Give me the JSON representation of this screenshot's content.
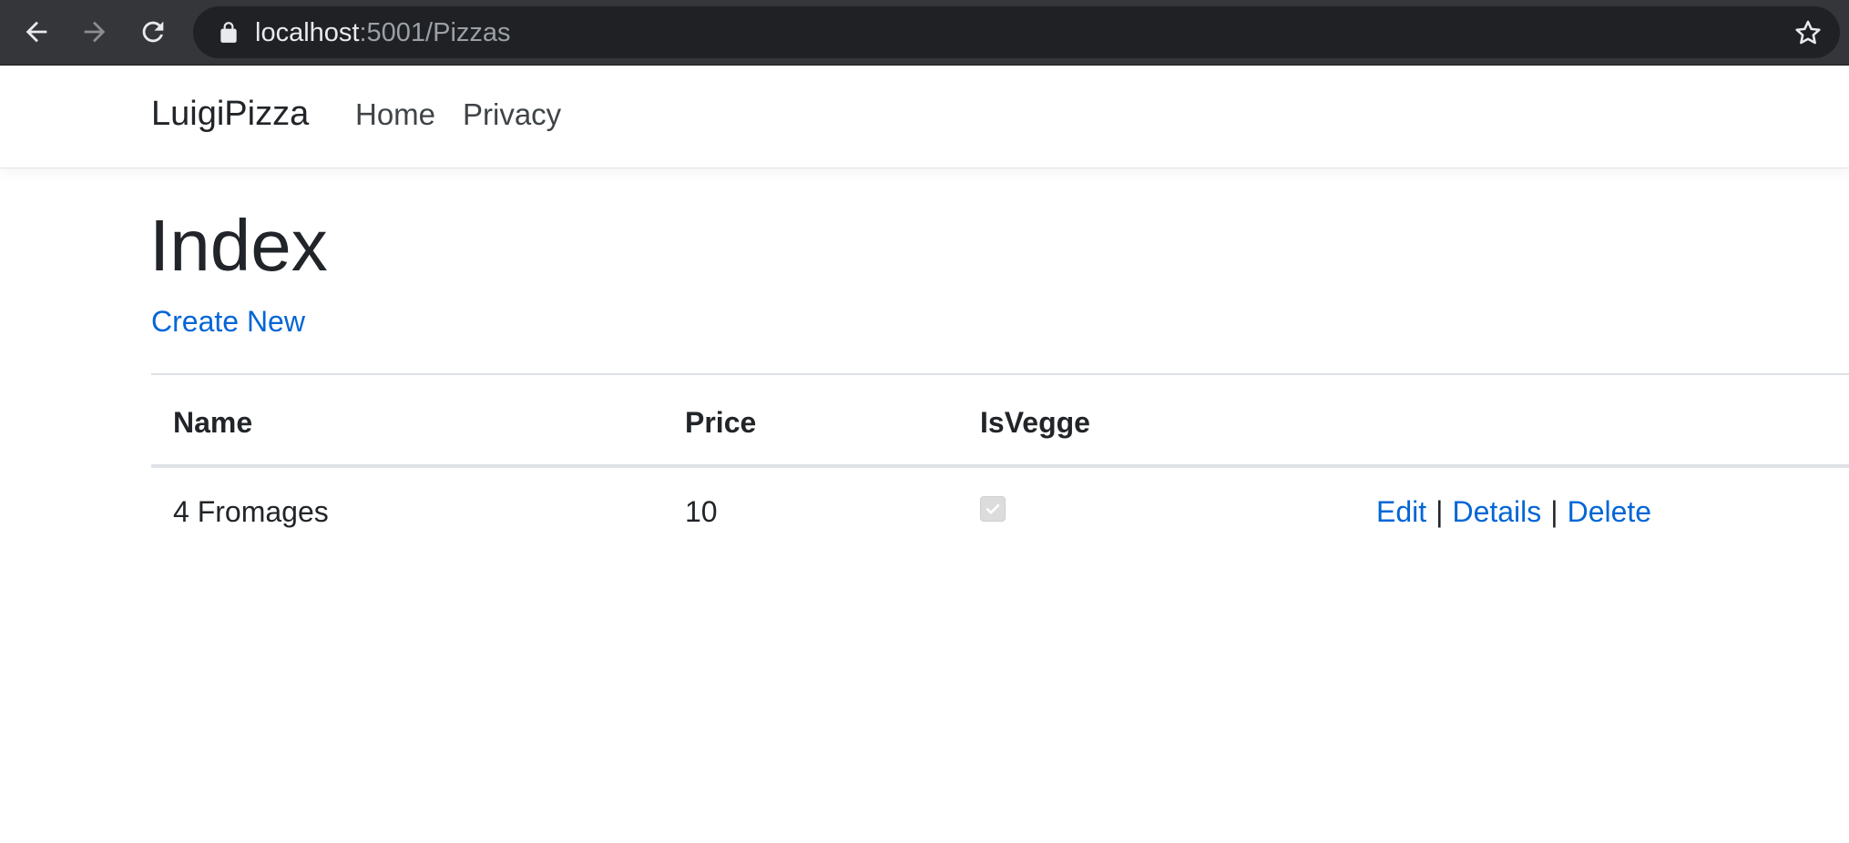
{
  "browser": {
    "url_host": "localhost",
    "url_path": ":5001/Pizzas"
  },
  "navbar": {
    "brand": "LuigiPizza",
    "links": [
      {
        "label": "Home"
      },
      {
        "label": "Privacy"
      }
    ]
  },
  "page": {
    "title": "Index",
    "create_link": "Create New"
  },
  "table": {
    "headers": [
      "Name",
      "Price",
      "IsVegge",
      ""
    ],
    "rows": [
      {
        "name": "4 Fromages",
        "price": "10",
        "is_vegge": true,
        "actions": [
          "Edit",
          "Details",
          "Delete"
        ],
        "separator": "|"
      }
    ]
  },
  "icons": {
    "back": "back-arrow-icon",
    "forward": "forward-arrow-icon",
    "reload": "reload-icon",
    "lock": "lock-icon",
    "bookmark": "star-icon",
    "check": "check-icon"
  },
  "colors": {
    "chrome_bg": "#35363a",
    "omnibox_bg": "#202124",
    "link": "#0366d6",
    "text": "#212529"
  }
}
